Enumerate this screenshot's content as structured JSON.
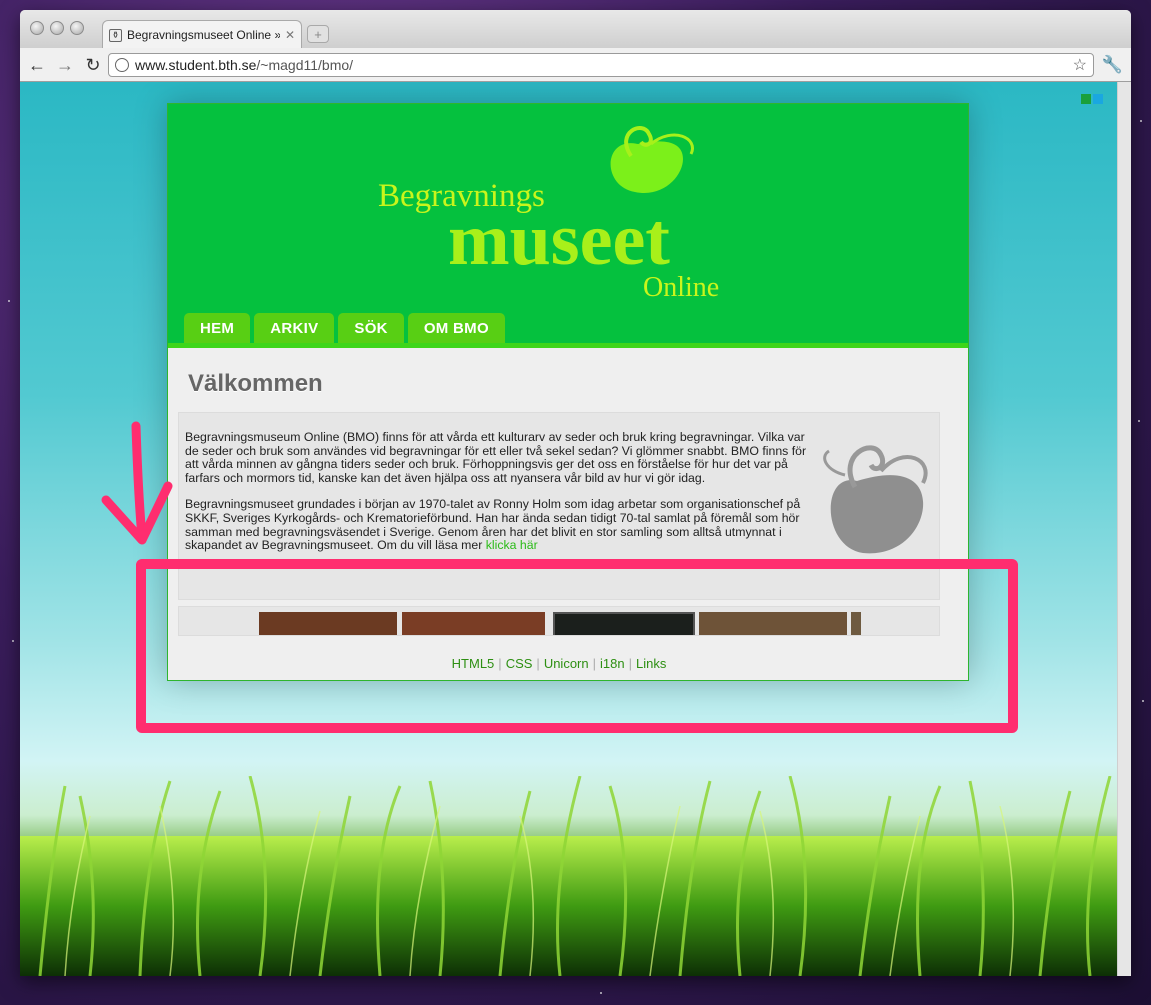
{
  "browser": {
    "tab_title": "Begravningsmuseet Online",
    "tab_title_suffix": "»",
    "url_host": "www.student.bth.se",
    "url_path": "/~magd11/bmo/"
  },
  "site": {
    "logo": {
      "line1": "Begravnings",
      "line2": "museet",
      "line3": "Online"
    },
    "nav": [
      "HEM",
      "ARKIV",
      "SÖK",
      "OM BMO"
    ],
    "heading": "Välkommen",
    "paragraph1": "Begravningsmuseum Online (BMO) finns för att vårda ett kulturarv av seder och bruk kring begravningar. Vilka var de seder och bruk som användes vid begravningar för ett eller två sekel sedan? Vi glömmer snabbt. BMO finns för att vårda minnen av gångna tiders seder och bruk. Förhoppningsvis ger det oss en förståelse för hur det var på farfars och mormors tid, kanske kan det även hjälpa oss att nyansera vår bild av hur vi gör idag.",
    "paragraph2_text": "Begravningsmuseet grundades i början av 1970-talet av Ronny Holm som idag arbetar som organisationschef på SKKF, Sveriges Kyrkogårds- och Krematorieförbund. Han har ända sedan tidigt 70-tal samlat på föremål som hör samman med begravningsväsendet i Sverige. Genom åren har det blivit en stor samling som alltså utmynnat i skapandet av Begravningsmuseet. Om du vill läsa mer ",
    "paragraph2_link": "klicka här",
    "footer_links": [
      "HTML5",
      "CSS",
      "Unicorn",
      "i18n",
      "Links"
    ]
  },
  "colors": {
    "header_green": "#05c13e",
    "nav_green": "#58cf14",
    "logo_lime": "#a8f01a",
    "annotation_pink": "#ff2d6f"
  },
  "icons": {
    "back": "arrow-left-icon",
    "forward": "arrow-right-icon",
    "reload": "reload-icon",
    "bookmark": "star-icon",
    "settings": "wrench-icon"
  }
}
